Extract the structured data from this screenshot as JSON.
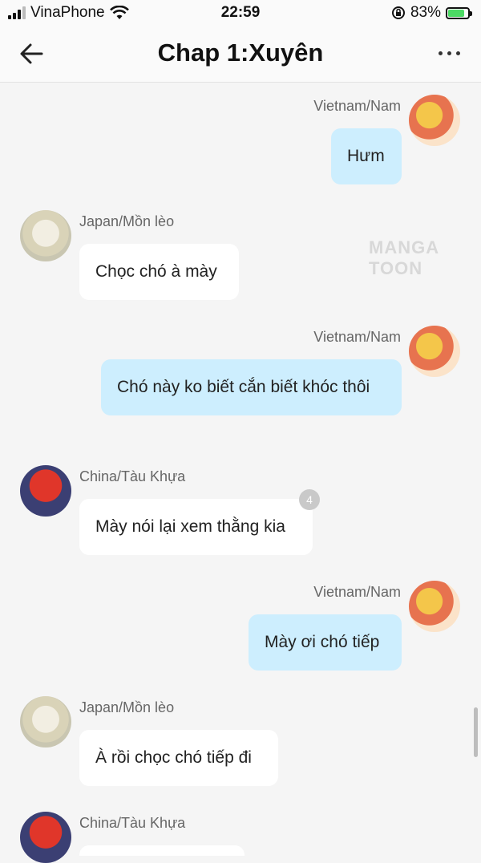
{
  "status_bar": {
    "carrier": "VinaPhone",
    "time": "22:59",
    "battery_percent": "83%",
    "battery_level": 0.83,
    "icons": [
      "signal-icon",
      "wifi-icon",
      "orientation-lock-icon",
      "battery-charging-icon"
    ]
  },
  "header": {
    "title": "Chap 1:Xuyên",
    "icons": [
      "back-arrow-icon",
      "more-options-icon"
    ]
  },
  "watermark": "MANGA TOON",
  "messages": [
    {
      "side": "right",
      "sender": "Vietnam/Nam",
      "text": "Hưm"
    },
    {
      "side": "left",
      "sender": "Japan/Mồn lèo",
      "text": "Chọc chó à mày"
    },
    {
      "side": "right",
      "sender": "Vietnam/Nam",
      "text": "Chó này ko biết cắn biết khóc thôi"
    },
    {
      "side": "left",
      "sender": "China/Tàu Khựa",
      "text": "Mày nói lại xem thằng kia",
      "badge": "4"
    },
    {
      "side": "right",
      "sender": "Vietnam/Nam",
      "text": "Mày ơi chó tiếp"
    },
    {
      "side": "left",
      "sender": "Japan/Mồn lèo",
      "text": "À rồi chọc chó tiếp đi"
    },
    {
      "side": "left",
      "sender": "China/Tàu Khựa",
      "text": ""
    }
  ],
  "colors": {
    "background": "#f5f5f5",
    "bubble_self": "#cdeefe",
    "bubble_other": "#ffffff",
    "battery_fill": "#4cd964"
  }
}
